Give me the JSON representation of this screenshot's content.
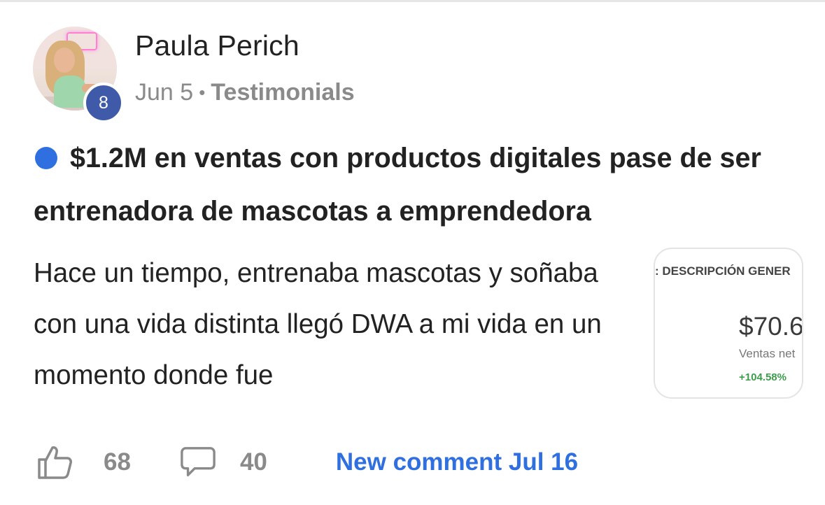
{
  "post": {
    "author": "Paula Perich",
    "author_level": "8",
    "date": "Jun 5",
    "separator": "•",
    "category": "Testimonials",
    "title": "$1.2M en ventas con productos digitales pase de ser entrenadora de mascotas a emprendedora",
    "excerpt": "Hace un tiempo, entrenaba mascotas y soñaba con una vida distinta llegó DWA a mi vida en un momento donde fue",
    "unread_color": "#2f6fe0"
  },
  "thumbnail": {
    "heading": ": DESCRIPCIÓN GENER",
    "amount": "$70.6",
    "subtitle": "Ventas net",
    "change": "+104.58%"
  },
  "footer": {
    "like_icon": "thumbs-up-icon",
    "like_count": "68",
    "comment_icon": "speech-bubble-icon",
    "comment_count": "40",
    "new_comment_label": "New comment Jul 16",
    "link_color": "#2f6fe0"
  }
}
